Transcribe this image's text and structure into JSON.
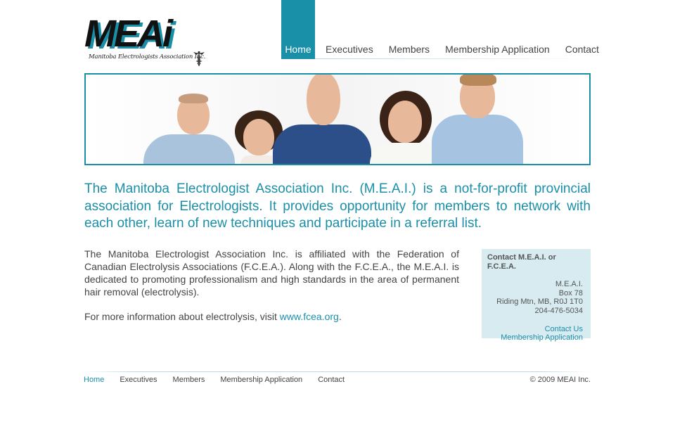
{
  "logo": {
    "word": "MEAi",
    "subtitle": "Manitoba Electrologists Association Inc."
  },
  "nav": {
    "items": [
      {
        "label": "Home",
        "active": true
      },
      {
        "label": "Executives"
      },
      {
        "label": "Members"
      },
      {
        "label": "Membership Application"
      },
      {
        "label": "Contact"
      }
    ]
  },
  "intro": "The Manitoba Electrologist Association Inc. (M.E.A.I.) is a not-for-profit provincial association for Electrologists. It provides opportunity for members to network with each other, learn of new techniques and participate in a referral list.",
  "body": {
    "paragraph": "The Manitoba Electrologist Association Inc. is affiliated with the Federation of Canadian Electrolysis Associations (F.C.E.A.). Along with the F.C.E.A., the M.E.A.I. is dedicated to promoting professionalism and high standards in the area of permanent hair removal (electrolysis).",
    "more_prefix": "For more information about electrolysis, visit ",
    "more_link": "www.fcea.org",
    "more_suffix": "."
  },
  "contact_box": {
    "title": "Contact M.E.A.I. or F.C.E.A.",
    "address": [
      "M.E.A.I.",
      "Box 78",
      "Riding Mtn, MB, R0J 1T0",
      "204-476-5034"
    ],
    "links": [
      "Contact Us",
      "Membership Application"
    ]
  },
  "footer": {
    "items": [
      {
        "label": "Home",
        "active": true
      },
      {
        "label": "Executives"
      },
      {
        "label": "Members"
      },
      {
        "label": "Membership Application"
      },
      {
        "label": "Contact"
      }
    ],
    "copyright": "© 2009 MEAI Inc."
  },
  "colors": {
    "accent": "#1a8fa8",
    "contact_box_bg": "#d7ebf0",
    "text": "#444444"
  }
}
